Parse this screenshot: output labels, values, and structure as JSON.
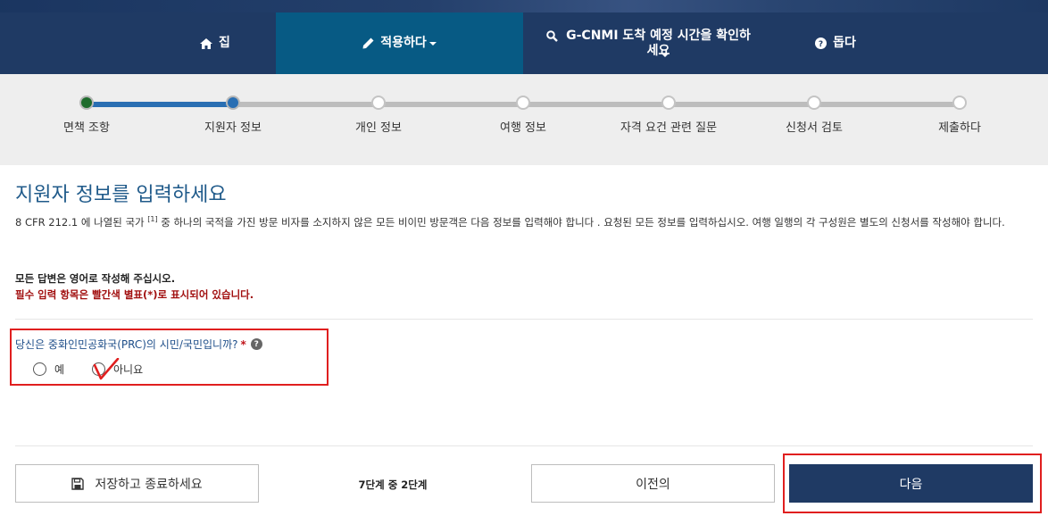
{
  "nav": {
    "home_label": "집",
    "apply_label": "적용하다",
    "check_label": "G-CNMI 도착 예정 시간을 확인하세요",
    "help_label": "돕다"
  },
  "steps": [
    {
      "label": "면책 조항",
      "state": "done"
    },
    {
      "label": "지원자 정보",
      "state": "current"
    },
    {
      "label": "개인 정보",
      "state": "todo"
    },
    {
      "label": "여행 정보",
      "state": "todo"
    },
    {
      "label": "자격 요건 관련 질문",
      "state": "todo"
    },
    {
      "label": "신청서 검토",
      "state": "todo"
    },
    {
      "label": "제출하다",
      "state": "todo"
    }
  ],
  "main": {
    "title": "지원자 정보를 입력하세요",
    "intro_before": "8 CFR 212.1 에 나열된 국가 ",
    "intro_sup": "[1]",
    "intro_after": " 중 하나의 국적을 가진 방문 비자를 소지하지 않은 모든 비이민 방문객은 다음 정보를 입력해야 합니다 . 요청된 모든 정보를 입력하십시오. 여행 일행의 각 구성원은 별도의 신청서를 작성해야 합니다.",
    "english_note": "모든 답변은 영어로 작성해 주십시오.",
    "required_note": "필수 입력 항목은 빨간색 별표(*)로 표시되어 있습니다.",
    "question": "당신은 중화인민공화국(PRC)의 시민/국민입니까?",
    "required_mark": "*",
    "help_glyph": "?",
    "option_yes": "예",
    "option_no": "아니요"
  },
  "footer": {
    "save_label": "저장하고 종료하세요",
    "step_count": "7단계 중 2단계",
    "prev_label": "이전의",
    "next_label": "다음"
  },
  "colors": {
    "nav_bg": "#1f3a64",
    "nav_active": "#075a84",
    "progress_fill": "#2a6fb3",
    "step_done": "#1e6b2c",
    "title": "#1f5a8a",
    "required": "#a10f0f",
    "highlight": "#e01f1f",
    "next_button": "#1f3a64"
  },
  "icons": [
    "home-icon",
    "pencil-icon",
    "search-icon",
    "question-circle-icon",
    "floppy-disk-icon",
    "caret-down-icon",
    "checkmark-annotation"
  ]
}
